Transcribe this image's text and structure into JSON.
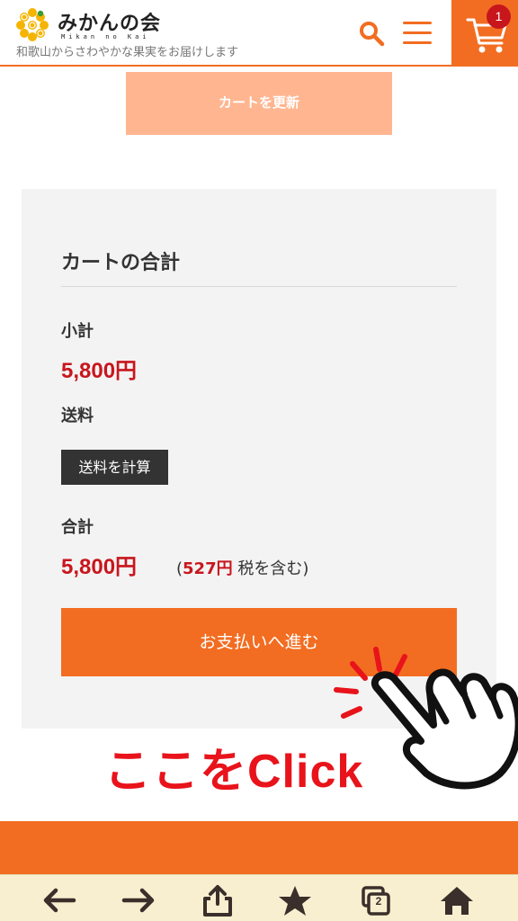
{
  "header": {
    "logo_text": "みかんの会",
    "logo_sub": "Mikan no Kai",
    "tagline": "和歌山からさわやかな果実をお届けします",
    "cart_count": "1",
    "icons": [
      "search-icon",
      "hamburger-menu-icon",
      "cart-icon"
    ],
    "accent_color": "#f26d21"
  },
  "cart": {
    "update_label": "カートを更新"
  },
  "totals": {
    "title": "カートの合計",
    "subtotal_label": "小計",
    "subtotal_value": "5,800円",
    "shipping_label": "送料",
    "shipping_button": "送料を計算",
    "total_label": "合計",
    "total_value": "5,800円",
    "tax_open": "(",
    "tax_amount": "527円",
    "tax_suffix": " 税を含む)",
    "checkout_label": "お支払いへ進む",
    "price_color": "#c8161d"
  },
  "annotation": {
    "text": "ここをClick"
  },
  "browser_toolbar": {
    "icons": [
      "back-arrow-icon",
      "forward-arrow-icon",
      "share-icon",
      "bookmark-star-icon",
      "tabs-icon",
      "home-icon"
    ],
    "tab_count": "2"
  }
}
